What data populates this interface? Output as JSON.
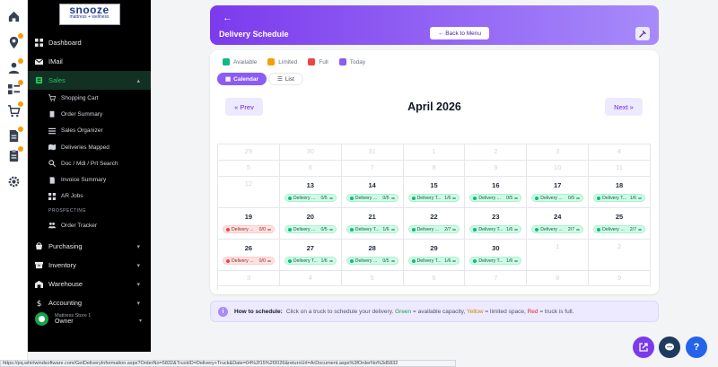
{
  "brand": {
    "name": "snooze",
    "tagline": "mattress + wellness"
  },
  "rail": [
    {
      "name": "home-icon"
    },
    {
      "name": "location-icon",
      "badge": true
    },
    {
      "name": "user-icon",
      "badge": true
    },
    {
      "name": "users-list-icon",
      "badge": true
    },
    {
      "name": "cart-icon",
      "badge": true
    },
    {
      "name": "document-icon",
      "badge": true
    },
    {
      "name": "clipboard-icon",
      "badge": true
    },
    {
      "name": "settings-icon"
    }
  ],
  "sidebar": {
    "items": [
      {
        "label": "Dashboard",
        "icon": "dashboard-icon"
      },
      {
        "label": "IMail",
        "icon": "mail-icon"
      },
      {
        "label": "Sales",
        "icon": "sales-icon",
        "active": true
      }
    ],
    "sales_sub": [
      {
        "label": "Shopping Cart",
        "icon": "cart-icon"
      },
      {
        "label": "Order Summary",
        "icon": "clipboard-icon"
      },
      {
        "label": "Sales Organizer",
        "icon": "list-icon"
      },
      {
        "label": "Deliveries Mapped",
        "icon": "map-icon"
      },
      {
        "label": "Doc / Mdl / Prt Search",
        "icon": "search-icon"
      },
      {
        "label": "Invoice Summary",
        "icon": "invoice-icon"
      },
      {
        "label": "AR Jobs",
        "icon": "grid-icon"
      }
    ],
    "prospecting_label": "PROSPECTING",
    "prospecting_sub": [
      {
        "label": "Order Tracker",
        "icon": "people-icon"
      }
    ],
    "bottom_items": [
      {
        "label": "Purchasing",
        "icon": "purchasing-icon"
      },
      {
        "label": "Inventory",
        "icon": "inventory-icon"
      },
      {
        "label": "Warehouse",
        "icon": "warehouse-icon"
      },
      {
        "label": "Accounting",
        "icon": "dollar-icon"
      }
    ],
    "user": {
      "store": "Mattress Store 1",
      "role": "Owner"
    }
  },
  "header": {
    "back_icon": "arrow-left-icon",
    "title": "Delivery Schedule",
    "back_button": "← Back to Menu",
    "tool_icon": "tools-icon"
  },
  "legend": [
    {
      "label": "Available",
      "color": "#10b981"
    },
    {
      "label": "Limited",
      "color": "#f59e0b"
    },
    {
      "label": "Full",
      "color": "#ef4444"
    },
    {
      "label": "Today",
      "color": "#8b5cf6"
    }
  ],
  "tabs": {
    "calendar": "Calendar",
    "list": "List"
  },
  "nav": {
    "prev": "« Prev",
    "next": "Next »",
    "month": "April 2026"
  },
  "calendar": {
    "weeks": [
      [
        {
          "d": "29",
          "o": true
        },
        {
          "d": "30",
          "o": true
        },
        {
          "d": "31",
          "o": true
        },
        {
          "d": "1",
          "o": true
        },
        {
          "d": "2",
          "o": true
        },
        {
          "d": "3",
          "o": true
        },
        {
          "d": "4",
          "o": true
        }
      ],
      [
        {
          "d": "5",
          "o": true
        },
        {
          "d": "6",
          "o": true
        },
        {
          "d": "7",
          "o": true
        },
        {
          "d": "8",
          "o": true
        },
        {
          "d": "9",
          "o": true
        },
        {
          "d": "10",
          "o": true
        },
        {
          "d": "11",
          "o": true
        }
      ],
      [
        {
          "d": "12",
          "o": true
        },
        {
          "d": "13",
          "pill": {
            "name": "Delivery ...",
            "count": "0/5",
            "status": "green"
          }
        },
        {
          "d": "14",
          "pill": {
            "name": "Delivery ...",
            "count": "0/5",
            "status": "green"
          }
        },
        {
          "d": "15",
          "pill": {
            "name": "Delivery T...",
            "count": "1/6",
            "status": "green"
          }
        },
        {
          "d": "16",
          "pill": {
            "name": "Delivery ...",
            "count": "0/5",
            "status": "green"
          }
        },
        {
          "d": "17",
          "pill": {
            "name": "Delivery ...",
            "count": "0/5",
            "status": "green"
          }
        },
        {
          "d": "18",
          "pill": {
            "name": "Delivery T...",
            "count": "1/6",
            "status": "green"
          }
        }
      ],
      [
        {
          "d": "19",
          "pill": {
            "name": "Delivery ...",
            "count": "0/0",
            "status": "red"
          }
        },
        {
          "d": "20",
          "pill": {
            "name": "Delivery ...",
            "count": "0/5",
            "status": "green"
          }
        },
        {
          "d": "21",
          "pill": {
            "name": "Delivery T...",
            "count": "1/6",
            "status": "green"
          }
        },
        {
          "d": "22",
          "pill": {
            "name": "Delivery ...",
            "count": "2/7",
            "status": "green"
          }
        },
        {
          "d": "23",
          "pill": {
            "name": "Delivery T...",
            "count": "1/6",
            "status": "green"
          }
        },
        {
          "d": "24",
          "pill": {
            "name": "Delivery ...",
            "count": "2/7",
            "status": "green"
          }
        },
        {
          "d": "25",
          "pill": {
            "name": "Delivery ...",
            "count": "2/7",
            "status": "green"
          }
        }
      ],
      [
        {
          "d": "26",
          "pill": {
            "name": "Delivery ...",
            "count": "0/0",
            "status": "red"
          }
        },
        {
          "d": "27",
          "pill": {
            "name": "Delivery T...",
            "count": "1/6",
            "status": "green"
          }
        },
        {
          "d": "28",
          "pill": {
            "name": "Delivery ...",
            "count": "0/5",
            "status": "green"
          }
        },
        {
          "d": "29",
          "pill": {
            "name": "Delivery T...",
            "count": "1/6",
            "status": "green"
          }
        },
        {
          "d": "30",
          "pill": {
            "name": "Delivery T...",
            "count": "1/6",
            "status": "green"
          }
        },
        {
          "d": "1",
          "o": true
        },
        {
          "d": "2",
          "o": true
        }
      ],
      [
        {
          "d": "3",
          "o": true
        },
        {
          "d": "4",
          "o": true
        },
        {
          "d": "5",
          "o": true
        },
        {
          "d": "6",
          "o": true
        },
        {
          "d": "7",
          "o": true
        },
        {
          "d": "8",
          "o": true
        },
        {
          "d": "9",
          "o": true
        }
      ]
    ]
  },
  "info": {
    "heading": "How to schedule:",
    "text1": "Click on a truck to schedule your delivery.",
    "green": "Green",
    "text2": "= available capacity,",
    "yellow": "Yellow",
    "text3": "= limited space,",
    "red": "Red",
    "text4": "= truck is full."
  },
  "status_url": "https://pq.whirlwindsoftware.com/GetDeliveryInformation.aspx?OrderNo=5832&TruckID=Delivery+Truck&Date=04%2f15%2f2026&returnUrl=ArDocument.aspx%3fOrderNo%3d5832",
  "fabs": [
    {
      "name": "external-link-button",
      "color": "#7c3aed"
    },
    {
      "name": "chat-button",
      "color": "#1e3a5f"
    },
    {
      "name": "help-button",
      "color": "#2563eb",
      "label": "?"
    }
  ]
}
